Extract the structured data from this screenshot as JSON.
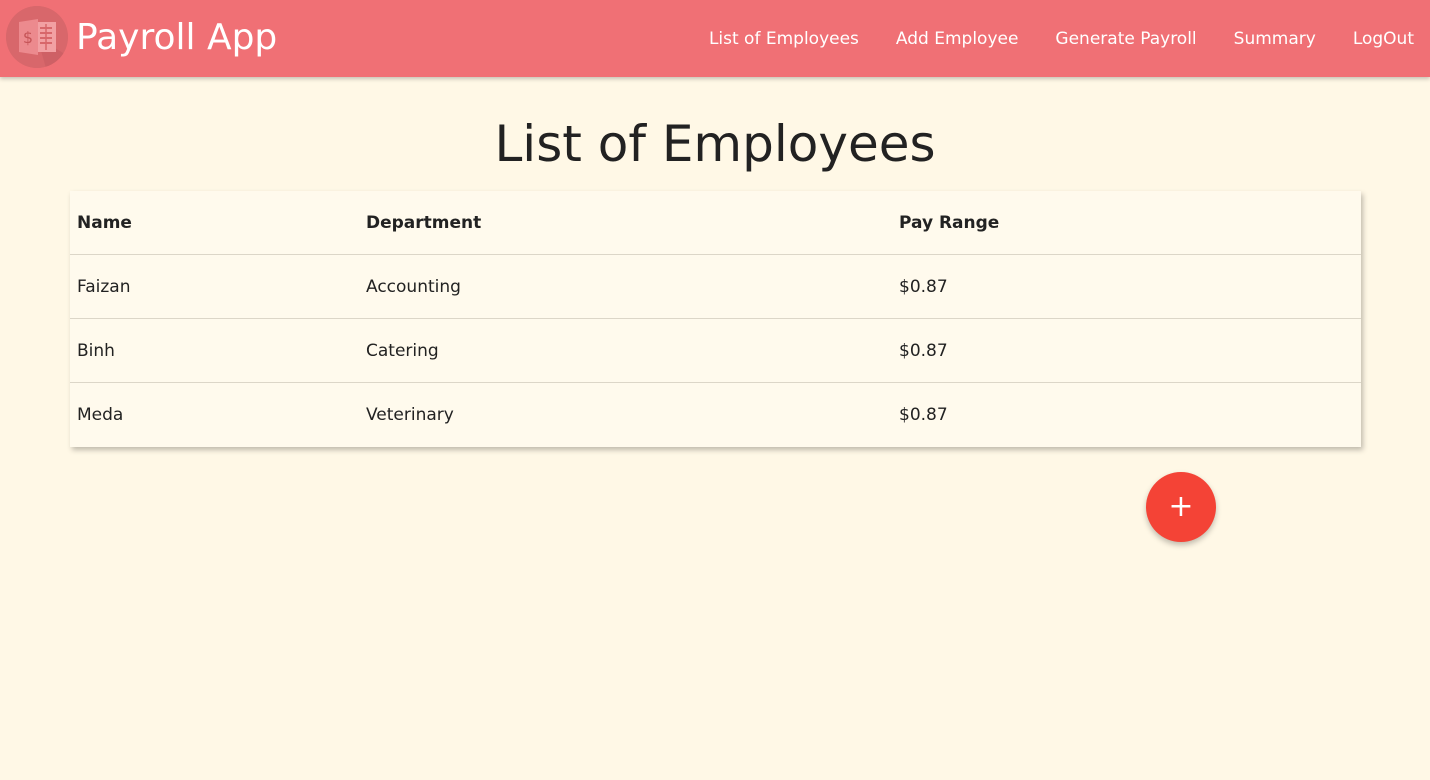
{
  "header": {
    "logo_icon": "payroll-spreadsheet-icon",
    "brand": "Payroll App",
    "nav": [
      {
        "label": "List of Employees"
      },
      {
        "label": "Add Employee"
      },
      {
        "label": "Generate Payroll"
      },
      {
        "label": "Summary"
      },
      {
        "label": "LogOut"
      }
    ]
  },
  "main": {
    "title": "List of Employees",
    "table": {
      "columns": [
        "Name",
        "Department",
        "Pay Range"
      ],
      "rows": [
        [
          "Faizan",
          "Accounting",
          "$0.87"
        ],
        [
          "Binh",
          "Catering",
          "$0.87"
        ],
        [
          "Meda",
          "Veterinary",
          "$0.87"
        ]
      ]
    },
    "fab": {
      "icon": "plus-icon",
      "label": "+"
    }
  },
  "colors": {
    "navbar": "#f07075",
    "background": "#fff8e6",
    "fab": "#f44336"
  }
}
